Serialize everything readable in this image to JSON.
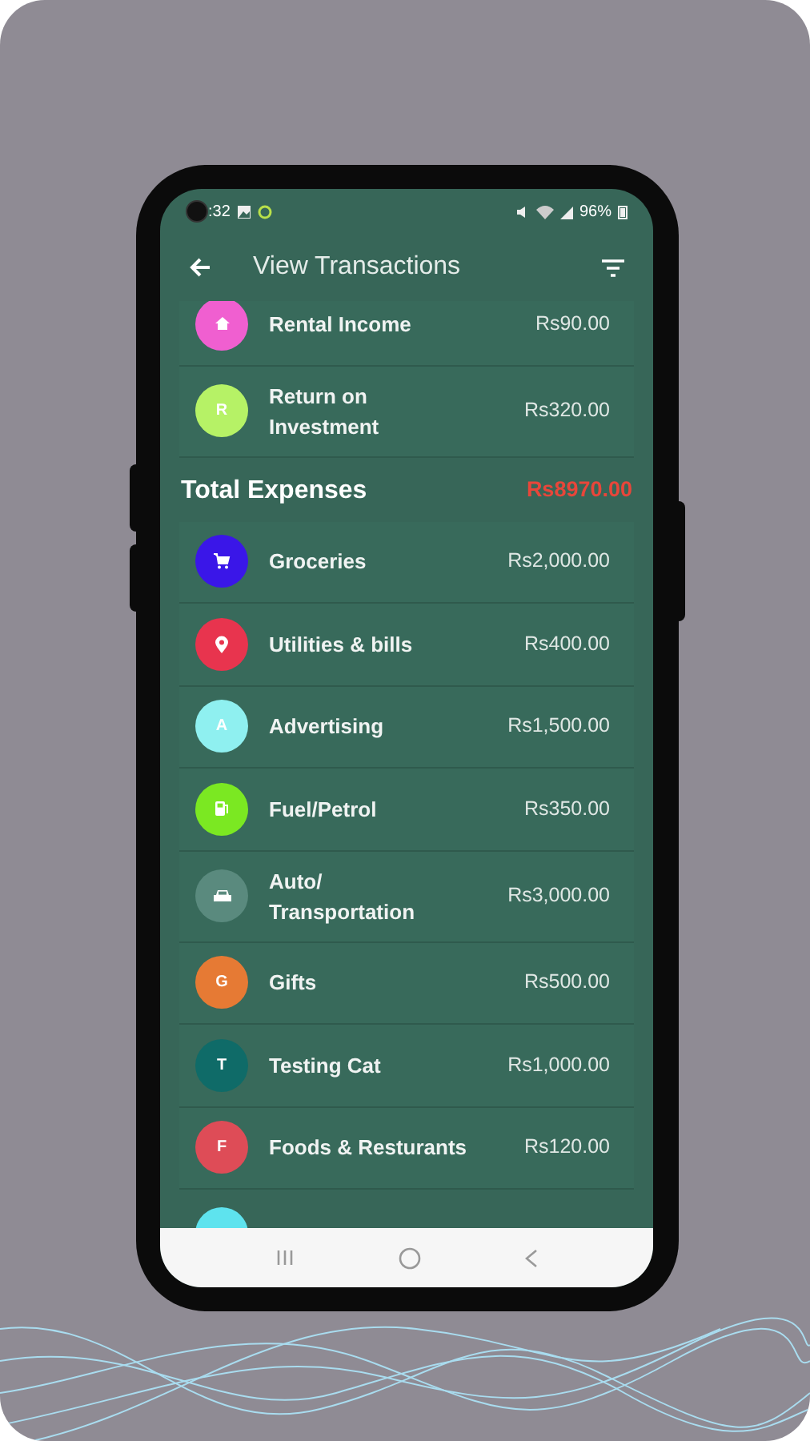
{
  "status_bar": {
    "time": ":32",
    "battery": "96%"
  },
  "app_bar": {
    "title": "View Transactions"
  },
  "income_items": [
    {
      "kind": "home",
      "label": "Rental Income",
      "amount": "Rs90.00",
      "color": "#f05fd0"
    },
    {
      "kind": "letter",
      "letter": "R",
      "label": "Return on Investment",
      "amount": "Rs320.00",
      "color": "#b6f266"
    }
  ],
  "expenses": {
    "title": "Total Expenses",
    "total": "Rs8970.00"
  },
  "expense_items": [
    {
      "kind": "cart",
      "label": "Groceries",
      "amount": "Rs2,000.00",
      "color": "#3a16e8"
    },
    {
      "kind": "pin",
      "label": "Utilities & bills",
      "amount": "Rs400.00",
      "color": "#e8344e"
    },
    {
      "kind": "letter",
      "letter": "A",
      "label": "Advertising",
      "amount": "Rs1,500.00",
      "color": "#8ff0f0"
    },
    {
      "kind": "fuel",
      "label": "Fuel/Petrol",
      "amount": "Rs350.00",
      "color": "#7be822"
    },
    {
      "kind": "car",
      "label": "Auto/ Transportation",
      "amount": "Rs3,000.00",
      "color": "#5a8a7e"
    },
    {
      "kind": "letter",
      "letter": "G",
      "label": "Gifts",
      "amount": "Rs500.00",
      "color": "#e67a34"
    },
    {
      "kind": "letter",
      "letter": "T",
      "label": "Testing Cat",
      "amount": "Rs1,000.00",
      "color": "#0f6b68"
    },
    {
      "kind": "letter",
      "letter": "F",
      "label": "Foods & Resturants",
      "amount": "Rs120.00",
      "color": "#de4c57"
    },
    {
      "kind": "partial",
      "color": "#5ee3ee"
    }
  ]
}
